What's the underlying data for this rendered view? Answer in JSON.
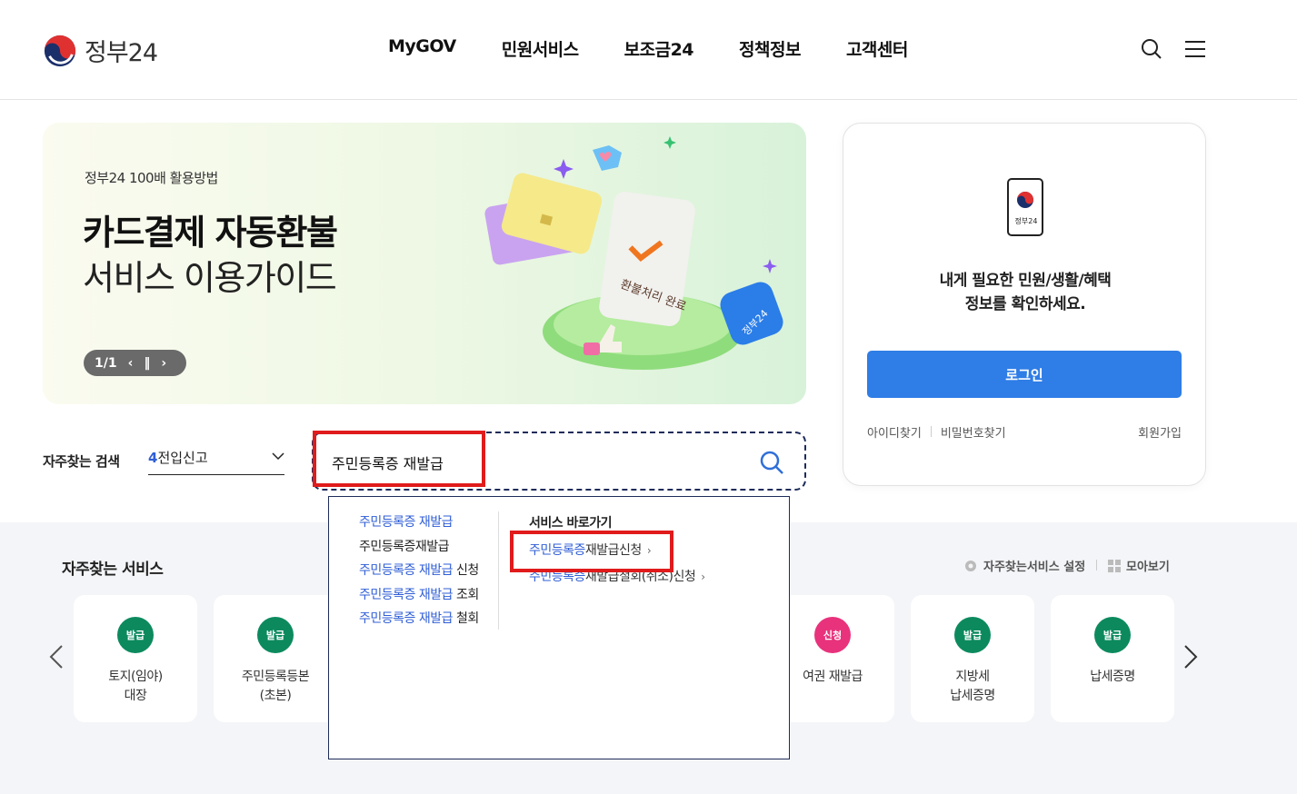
{
  "header": {
    "logo_text": "정부24",
    "nav": [
      "MyGOV",
      "민원서비스",
      "보조금24",
      "정책정보",
      "고객센터"
    ]
  },
  "banner": {
    "subtitle": "정부24 100배 활용방법",
    "title_line1": "카드결제 자동환불",
    "title_line2": "서비스 이용가이드",
    "pager": "1/1",
    "art_label": "환불처리 완료",
    "art_badge": "정부24"
  },
  "login": {
    "icon_label": "정부24",
    "message_line1": "내게 필요한 민원/생활/혜택",
    "message_line2": "정보를 확인하세요.",
    "button": "로그인",
    "find_id": "아이디찾기",
    "find_pw": "비밀번호찾기",
    "signup": "회원가입"
  },
  "frequent_search": {
    "label": "자주찾는 검색",
    "selected_num": "4",
    "selected_text": "전입신고"
  },
  "search": {
    "value": "주민등록증 재발급"
  },
  "autocomplete": {
    "suggestions": [
      {
        "match": "주민등록증 재발급",
        "rest": ""
      },
      {
        "match": "",
        "rest": "주민등록증재발급"
      },
      {
        "match": "주민등록증 재발급",
        "rest": " 신청"
      },
      {
        "match": "주민등록증 재발급",
        "rest": " 조회"
      },
      {
        "match": "주민등록증 재발급",
        "rest": " 철회"
      }
    ],
    "shortcut_heading": "서비스 바로가기",
    "shortcuts": [
      {
        "match": "주민등록증",
        "rest": "재발급신청"
      },
      {
        "match": "주민등록증",
        "rest": "재발급철회(취소)신청"
      }
    ]
  },
  "services": {
    "title": "자주찾는 서비스",
    "settings": "자주찾는서비스 설정",
    "view_all": "모아보기",
    "cards": [
      {
        "badge": "발급",
        "label": "토지(임야)\n대장",
        "color": "#0c8a5e"
      },
      {
        "badge": "발급",
        "label": "주민등록등본\n(초본)",
        "color": "#0c8a5e"
      },
      {
        "badge": "신청",
        "label": "여권 재발급",
        "color": "#e8327c"
      },
      {
        "badge": "발급",
        "label": "지방세\n납세증명",
        "color": "#0c8a5e"
      },
      {
        "badge": "발급",
        "label": "납세증명",
        "color": "#0c8a5e"
      }
    ]
  },
  "colors": {
    "primary": "#2f7de6",
    "highlight": "#e01b1b",
    "link_blue": "#2f5ed6"
  }
}
